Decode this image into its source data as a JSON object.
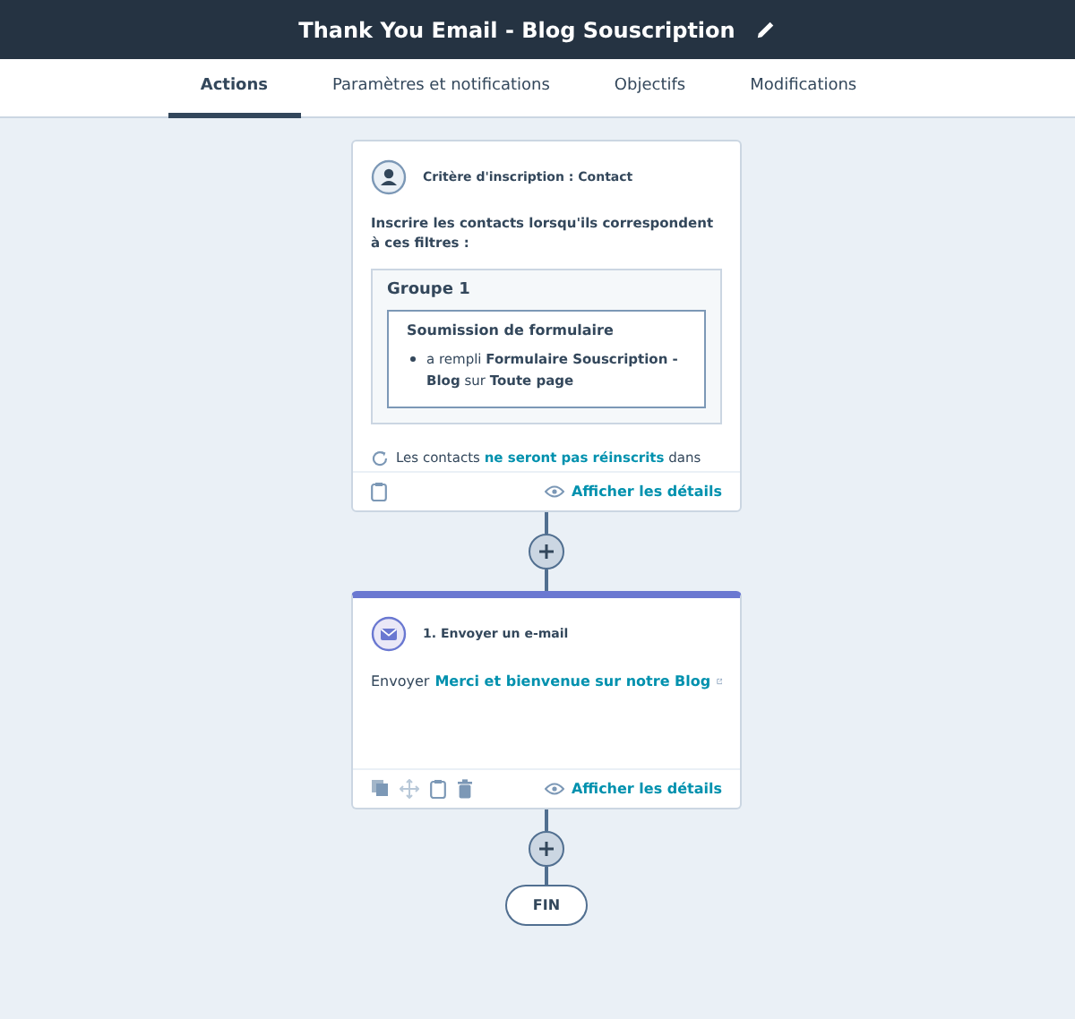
{
  "header": {
    "title": "Thank You Email - Blog Souscription"
  },
  "tabs": [
    {
      "label": "Actions",
      "selected": true
    },
    {
      "label": "Paramètres et notifications",
      "selected": false
    },
    {
      "label": "Objectifs",
      "selected": false
    },
    {
      "label": "Modifications",
      "selected": false
    }
  ],
  "trigger": {
    "title": "Critère d'inscription : Contact",
    "intro": "Inscrire les contacts lorsqu'ils correspondent à ces filtres :",
    "group_title": "Groupe 1",
    "filter_title": "Soumission de formulaire",
    "filter_rule": "a rempli **Formulaire Souscription - Blog** sur **Toute page**",
    "reenroll_before": "Les contacts",
    "reenroll_link": "ne seront pas réinscrits",
    "reenroll_after": "dans",
    "details_link": "Afficher les détails"
  },
  "action": {
    "title": "1. Envoyer un e-mail",
    "send_label": "Envoyer",
    "email_link": "Merci et bienvenue sur notre Blog",
    "details_link": "Afficher les détails"
  },
  "end": {
    "label": "FIN"
  }
}
